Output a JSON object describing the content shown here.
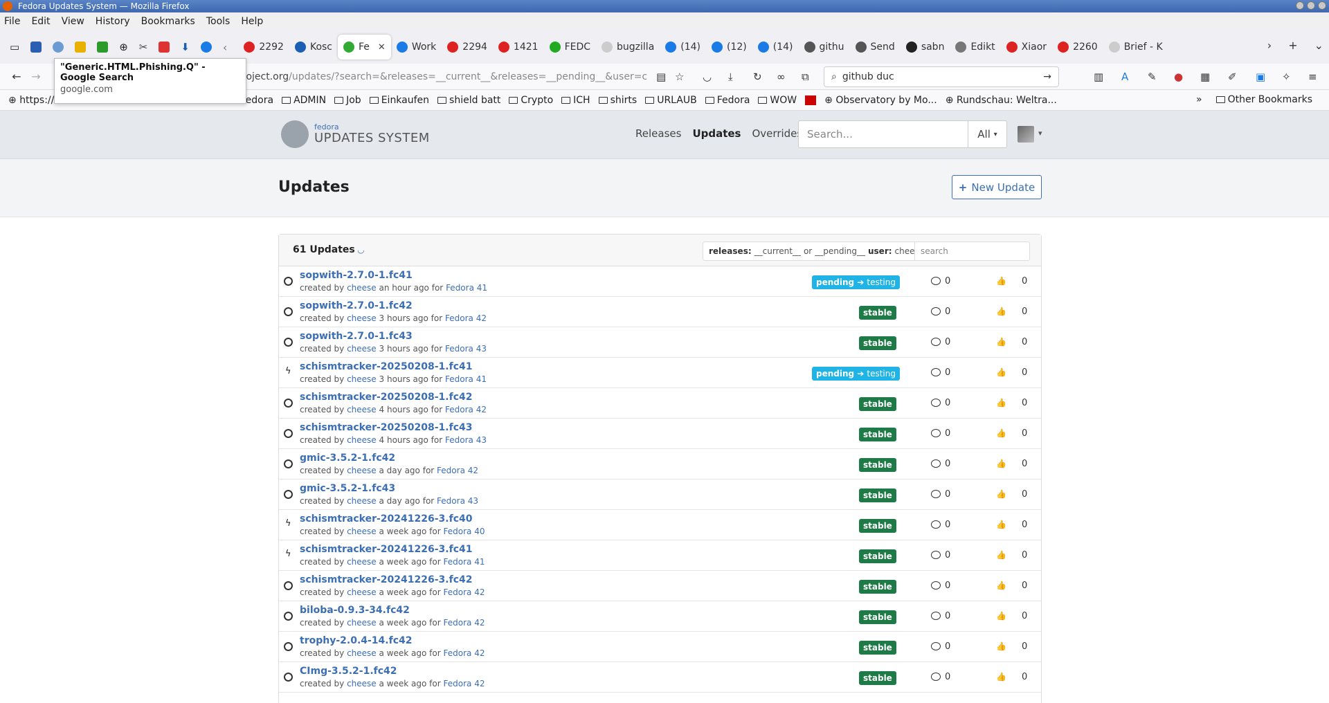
{
  "window": {
    "title": "Fedora Updates System — Mozilla Firefox"
  },
  "menu": [
    "File",
    "Edit",
    "View",
    "History",
    "Bookmarks",
    "Tools",
    "Help"
  ],
  "tabs": [
    {
      "label": "2292",
      "color": "#d22"
    },
    {
      "label": "Kosc",
      "color": "#1a5fb4"
    },
    {
      "label": "Fe",
      "color": "#3a3",
      "active": true
    },
    {
      "label": "Work",
      "color": "#1a7ae6"
    },
    {
      "label": "2294",
      "color": "#d22"
    },
    {
      "label": "1421",
      "color": "#d22"
    },
    {
      "label": "FEDC",
      "color": "#2a2"
    },
    {
      "label": "bugzilla",
      "color": "#ccc"
    },
    {
      "label": "(14)",
      "color": "#1a7ae6"
    },
    {
      "label": "(12)",
      "color": "#1a7ae6"
    },
    {
      "label": "(14)",
      "color": "#1a7ae6"
    },
    {
      "label": "githu",
      "color": "#555"
    },
    {
      "label": "Send",
      "color": "#555"
    },
    {
      "label": "sabn",
      "color": "#222"
    },
    {
      "label": "Edikt",
      "color": "#777"
    },
    {
      "label": "Xiaor",
      "color": "#d22"
    },
    {
      "label": "2260",
      "color": "#d22"
    },
    {
      "label": "Brief - K",
      "color": "#ccc"
    }
  ],
  "nav": {
    "url_main": "roject.org",
    "url_rest": "/updates/?search=&releases=__current__&releases=__pending__&user=c",
    "search_value": "github duc"
  },
  "tooltip": {
    "title": "\"Generic.HTML.Phishing.Q\" - Google Search",
    "url": "google.com"
  },
  "bookmarks": {
    "first": "https://",
    "folders": [
      "Fedora",
      "ADMIN",
      "Job",
      "Einkaufen",
      "shield batt",
      "Crypto",
      "ICH",
      "shirts",
      "URLAUB",
      "Fedora",
      "WOW"
    ],
    "sites": [
      "Observatory by Mo...",
      "Rundschau: Weltra..."
    ],
    "other": "Other Bookmarks"
  },
  "app": {
    "logo_small": "fedora",
    "logo_big": "UPDATES SYSTEM",
    "nav": [
      "Releases",
      "Updates",
      "Overrides"
    ],
    "search_placeholder": "Search...",
    "search_scope": "All"
  },
  "page": {
    "title": "Updates",
    "new_update": "New Update",
    "count": "61 Updates",
    "filter": {
      "releases_label": "releases:",
      "r1": "__current__",
      "or": "or",
      "r2": "__pending__",
      "user_label": "user:",
      "user": "cheese"
    },
    "filter_search_placeholder": "search"
  },
  "updates": [
    {
      "title": "sopwith-2.7.0-1.fc41",
      "by": "cheese",
      "when": "an hour ago",
      "release": "Fedora 41",
      "status": "pending",
      "target": "testing",
      "icon": "circle",
      "comments": "0",
      "karma": "0"
    },
    {
      "title": "sopwith-2.7.0-1.fc42",
      "by": "cheese",
      "when": "3 hours ago",
      "release": "Fedora 42",
      "status": "stable",
      "icon": "circle",
      "comments": "0",
      "karma": "0"
    },
    {
      "title": "sopwith-2.7.0-1.fc43",
      "by": "cheese",
      "when": "3 hours ago",
      "release": "Fedora 43",
      "status": "stable",
      "icon": "circle",
      "comments": "0",
      "karma": "0"
    },
    {
      "title": "schismtracker-20250208-1.fc41",
      "by": "cheese",
      "when": "3 hours ago",
      "release": "Fedora 41",
      "status": "pending",
      "target": "testing",
      "icon": "bolt",
      "comments": "0",
      "karma": "0"
    },
    {
      "title": "schismtracker-20250208-1.fc42",
      "by": "cheese",
      "when": "4 hours ago",
      "release": "Fedora 42",
      "status": "stable",
      "icon": "circle",
      "comments": "0",
      "karma": "0"
    },
    {
      "title": "schismtracker-20250208-1.fc43",
      "by": "cheese",
      "when": "4 hours ago",
      "release": "Fedora 43",
      "status": "stable",
      "icon": "circle",
      "comments": "0",
      "karma": "0"
    },
    {
      "title": "gmic-3.5.2-1.fc42",
      "by": "cheese",
      "when": "a day ago",
      "release": "Fedora 42",
      "status": "stable",
      "icon": "circle",
      "comments": "0",
      "karma": "0"
    },
    {
      "title": "gmic-3.5.2-1.fc43",
      "by": "cheese",
      "when": "a day ago",
      "release": "Fedora 43",
      "status": "stable",
      "icon": "circle",
      "comments": "0",
      "karma": "0"
    },
    {
      "title": "schismtracker-20241226-3.fc40",
      "by": "cheese",
      "when": "a week ago",
      "release": "Fedora 40",
      "status": "stable",
      "icon": "bolt",
      "comments": "0",
      "karma": "0"
    },
    {
      "title": "schismtracker-20241226-3.fc41",
      "by": "cheese",
      "when": "a week ago",
      "release": "Fedora 41",
      "status": "stable",
      "icon": "bolt",
      "comments": "0",
      "karma": "0"
    },
    {
      "title": "schismtracker-20241226-3.fc42",
      "by": "cheese",
      "when": "a week ago",
      "release": "Fedora 42",
      "status": "stable",
      "icon": "circle",
      "comments": "0",
      "karma": "0"
    },
    {
      "title": "biloba-0.9.3-34.fc42",
      "by": "cheese",
      "when": "a week ago",
      "release": "Fedora 42",
      "status": "stable",
      "icon": "circle",
      "comments": "0",
      "karma": "0"
    },
    {
      "title": "trophy-2.0.4-14.fc42",
      "by": "cheese",
      "when": "a week ago",
      "release": "Fedora 42",
      "status": "stable",
      "icon": "circle",
      "comments": "0",
      "karma": "0"
    },
    {
      "title": "CImg-3.5.2-1.fc42",
      "by": "cheese",
      "when": "a week ago",
      "release": "Fedora 42",
      "status": "stable",
      "icon": "circle",
      "comments": "0",
      "karma": "0"
    }
  ],
  "labels": {
    "created_by": "created by",
    "for": "for",
    "arrow": "➔"
  }
}
